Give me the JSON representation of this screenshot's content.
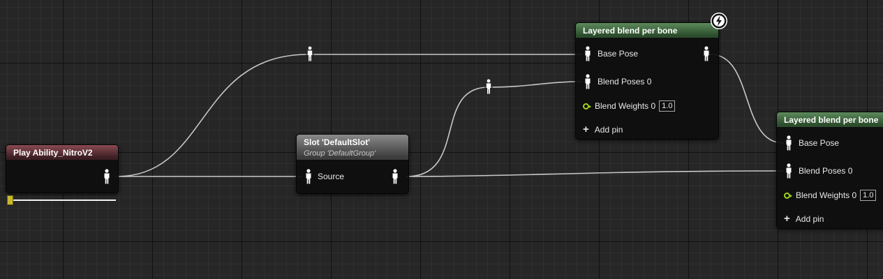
{
  "nodes": {
    "play_ability": {
      "title": "Play Ability_NitroV2",
      "progress": 0.0
    },
    "slot": {
      "title": "Slot 'DefaultSlot'",
      "subtitle": "Group 'DefaultGroup'",
      "source_label": "Source"
    },
    "blend1": {
      "title": "Layered blend per bone",
      "base_pose_label": "Base Pose",
      "blend_poses_label": "Blend Poses 0",
      "blend_weights_label": "Blend Weights 0",
      "blend_weights_value": "1.0",
      "add_pin_label": "Add pin"
    },
    "blend2": {
      "title": "Layered blend per bone",
      "base_pose_label": "Base Pose",
      "blend_poses_label": "Blend Poses 0",
      "blend_weights_label": "Blend Weights 0",
      "blend_weights_value": "1.0",
      "add_pin_label": "Add pin"
    }
  },
  "icons": {
    "pose_pin": "person-icon",
    "float_pin": "ring-icon",
    "add": "plus-icon",
    "fast_path": "lightning-icon"
  },
  "colors": {
    "graph_bg": "#262626",
    "wire": "#c8c8c8",
    "float_pin": "#9ed51a",
    "anim_header": "#4f7a4f",
    "montage_header": "#7a3a42",
    "slot_header": "#7a7a7a"
  }
}
